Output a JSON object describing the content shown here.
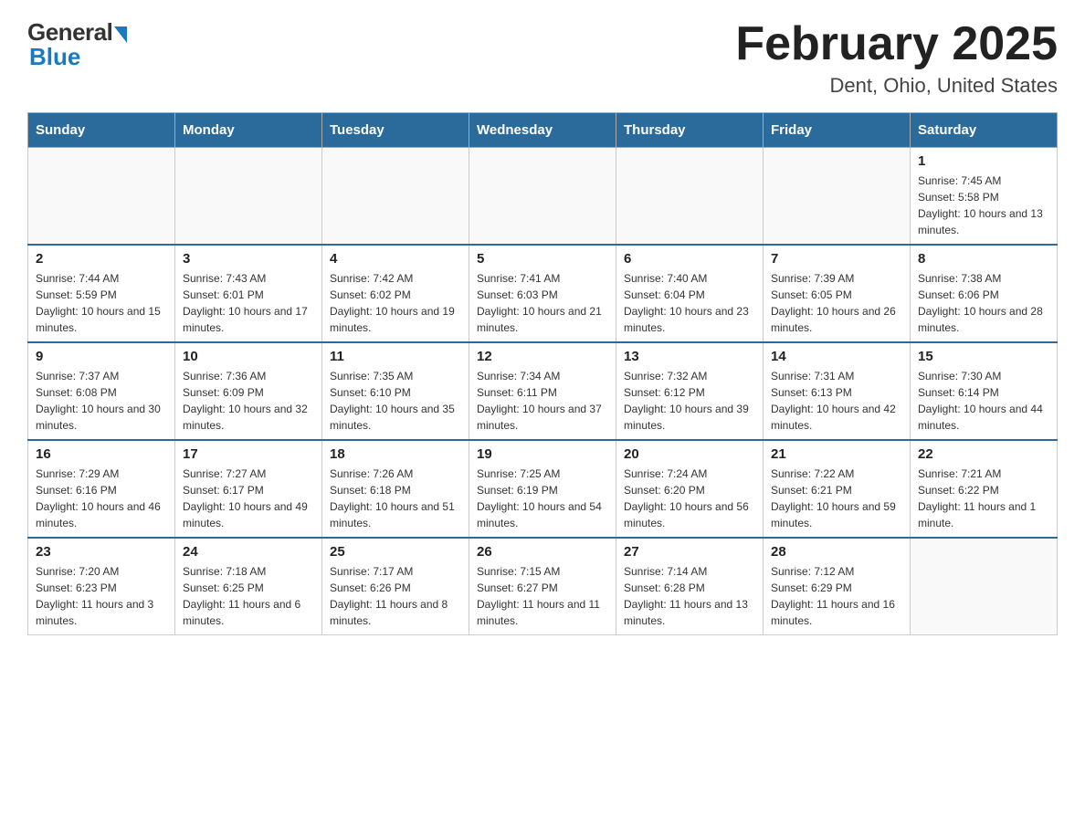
{
  "logo": {
    "general": "General",
    "blue": "Blue"
  },
  "header": {
    "title": "February 2025",
    "subtitle": "Dent, Ohio, United States"
  },
  "weekdays": [
    "Sunday",
    "Monday",
    "Tuesday",
    "Wednesday",
    "Thursday",
    "Friday",
    "Saturday"
  ],
  "weeks": [
    [
      {
        "day": "",
        "info": ""
      },
      {
        "day": "",
        "info": ""
      },
      {
        "day": "",
        "info": ""
      },
      {
        "day": "",
        "info": ""
      },
      {
        "day": "",
        "info": ""
      },
      {
        "day": "",
        "info": ""
      },
      {
        "day": "1",
        "info": "Sunrise: 7:45 AM\nSunset: 5:58 PM\nDaylight: 10 hours and 13 minutes."
      }
    ],
    [
      {
        "day": "2",
        "info": "Sunrise: 7:44 AM\nSunset: 5:59 PM\nDaylight: 10 hours and 15 minutes."
      },
      {
        "day": "3",
        "info": "Sunrise: 7:43 AM\nSunset: 6:01 PM\nDaylight: 10 hours and 17 minutes."
      },
      {
        "day": "4",
        "info": "Sunrise: 7:42 AM\nSunset: 6:02 PM\nDaylight: 10 hours and 19 minutes."
      },
      {
        "day": "5",
        "info": "Sunrise: 7:41 AM\nSunset: 6:03 PM\nDaylight: 10 hours and 21 minutes."
      },
      {
        "day": "6",
        "info": "Sunrise: 7:40 AM\nSunset: 6:04 PM\nDaylight: 10 hours and 23 minutes."
      },
      {
        "day": "7",
        "info": "Sunrise: 7:39 AM\nSunset: 6:05 PM\nDaylight: 10 hours and 26 minutes."
      },
      {
        "day": "8",
        "info": "Sunrise: 7:38 AM\nSunset: 6:06 PM\nDaylight: 10 hours and 28 minutes."
      }
    ],
    [
      {
        "day": "9",
        "info": "Sunrise: 7:37 AM\nSunset: 6:08 PM\nDaylight: 10 hours and 30 minutes."
      },
      {
        "day": "10",
        "info": "Sunrise: 7:36 AM\nSunset: 6:09 PM\nDaylight: 10 hours and 32 minutes."
      },
      {
        "day": "11",
        "info": "Sunrise: 7:35 AM\nSunset: 6:10 PM\nDaylight: 10 hours and 35 minutes."
      },
      {
        "day": "12",
        "info": "Sunrise: 7:34 AM\nSunset: 6:11 PM\nDaylight: 10 hours and 37 minutes."
      },
      {
        "day": "13",
        "info": "Sunrise: 7:32 AM\nSunset: 6:12 PM\nDaylight: 10 hours and 39 minutes."
      },
      {
        "day": "14",
        "info": "Sunrise: 7:31 AM\nSunset: 6:13 PM\nDaylight: 10 hours and 42 minutes."
      },
      {
        "day": "15",
        "info": "Sunrise: 7:30 AM\nSunset: 6:14 PM\nDaylight: 10 hours and 44 minutes."
      }
    ],
    [
      {
        "day": "16",
        "info": "Sunrise: 7:29 AM\nSunset: 6:16 PM\nDaylight: 10 hours and 46 minutes."
      },
      {
        "day": "17",
        "info": "Sunrise: 7:27 AM\nSunset: 6:17 PM\nDaylight: 10 hours and 49 minutes."
      },
      {
        "day": "18",
        "info": "Sunrise: 7:26 AM\nSunset: 6:18 PM\nDaylight: 10 hours and 51 minutes."
      },
      {
        "day": "19",
        "info": "Sunrise: 7:25 AM\nSunset: 6:19 PM\nDaylight: 10 hours and 54 minutes."
      },
      {
        "day": "20",
        "info": "Sunrise: 7:24 AM\nSunset: 6:20 PM\nDaylight: 10 hours and 56 minutes."
      },
      {
        "day": "21",
        "info": "Sunrise: 7:22 AM\nSunset: 6:21 PM\nDaylight: 10 hours and 59 minutes."
      },
      {
        "day": "22",
        "info": "Sunrise: 7:21 AM\nSunset: 6:22 PM\nDaylight: 11 hours and 1 minute."
      }
    ],
    [
      {
        "day": "23",
        "info": "Sunrise: 7:20 AM\nSunset: 6:23 PM\nDaylight: 11 hours and 3 minutes."
      },
      {
        "day": "24",
        "info": "Sunrise: 7:18 AM\nSunset: 6:25 PM\nDaylight: 11 hours and 6 minutes."
      },
      {
        "day": "25",
        "info": "Sunrise: 7:17 AM\nSunset: 6:26 PM\nDaylight: 11 hours and 8 minutes."
      },
      {
        "day": "26",
        "info": "Sunrise: 7:15 AM\nSunset: 6:27 PM\nDaylight: 11 hours and 11 minutes."
      },
      {
        "day": "27",
        "info": "Sunrise: 7:14 AM\nSunset: 6:28 PM\nDaylight: 11 hours and 13 minutes."
      },
      {
        "day": "28",
        "info": "Sunrise: 7:12 AM\nSunset: 6:29 PM\nDaylight: 11 hours and 16 minutes."
      },
      {
        "day": "",
        "info": ""
      }
    ]
  ]
}
